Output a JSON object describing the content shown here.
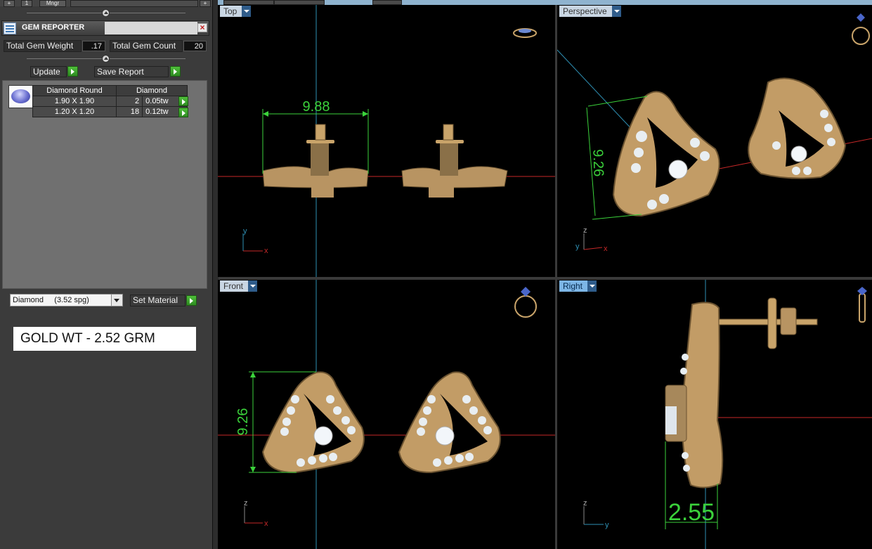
{
  "colors": {
    "panel": "#3b3b3b",
    "viewport": "#000000",
    "dimension": "#3bd23b",
    "gold": "#c9a46a",
    "axis_red": "#c62828",
    "axis_blue": "#2e8fb3",
    "go_green": "#3fae2e"
  },
  "toolbar": {
    "add": "+",
    "one": "1",
    "mngr": "Mngr",
    "add_right": "+"
  },
  "gem_reporter": {
    "title": "GEM REPORTER",
    "close": "×",
    "total_weight_label": "Total Gem Weight",
    "total_weight_value": ".17",
    "total_count_label": "Total Gem Count",
    "total_count_value": "20",
    "update_label": "Update",
    "save_report_label": "Save Report",
    "gem_icon": "round-diamond-icon",
    "table": {
      "headers": [
        "Diamond Round",
        "Diamond"
      ],
      "rows": [
        {
          "size": "1.90 X 1.90",
          "count": "2",
          "weight": "0.05tw"
        },
        {
          "size": "1.20 X 1.20",
          "count": "18",
          "weight": "0.12tw"
        }
      ]
    },
    "material_select": "Diamond     (3.52 spg)",
    "set_material_label": "Set Material",
    "gold_weight_note": "GOLD WT - 2.52 GRM"
  },
  "viewports": {
    "top": {
      "label": "Top",
      "dimension": "9.88",
      "axes": [
        "y",
        "x"
      ],
      "gizmo": "earring-top-view-icon"
    },
    "perspective": {
      "label": "Perspective",
      "dimension": "9.26",
      "axes": [
        "z",
        "y",
        "x"
      ],
      "gizmo": "ring-icon"
    },
    "front": {
      "label": "Front",
      "dimension": "9.26",
      "axes": [
        "z",
        "x"
      ],
      "gizmo": "ring-icon"
    },
    "right": {
      "label": "Right",
      "dimension": "2.55",
      "axes": [
        "z",
        "y"
      ],
      "gizmo": "ring-side-icon"
    }
  }
}
